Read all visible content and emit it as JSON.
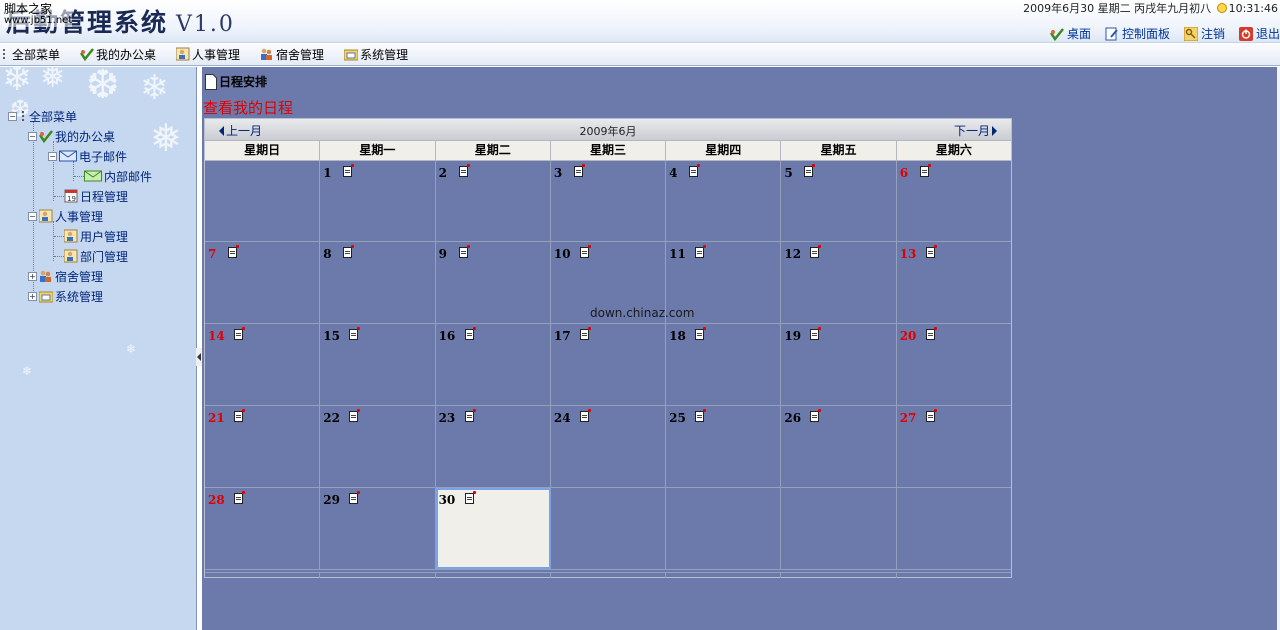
{
  "header": {
    "title": "后勤管理系统",
    "version": "V1.0",
    "watermark_line1": "脚本之家",
    "watermark_line2": "www.jb51.net",
    "datetime_date": "2009年6月30",
    "datetime_weekday": "星期二",
    "datetime_lunar": "丙戌年九月初八",
    "datetime_time": "10:31:46",
    "links": [
      "桌面",
      "控制面板",
      "注销",
      "退出"
    ]
  },
  "menubar": {
    "items": [
      {
        "label": "全部菜单",
        "icon": "dotted-menu-icon"
      },
      {
        "label": "我的办公桌",
        "icon": "check-leaf-icon"
      },
      {
        "label": "人事管理",
        "icon": "person-card-icon"
      },
      {
        "label": "宿舍管理",
        "icon": "people-group-icon"
      },
      {
        "label": "系统管理",
        "icon": "folder-window-icon"
      }
    ]
  },
  "tree": {
    "root": "全部菜单",
    "desk": "我的办公桌",
    "email": "电子邮件",
    "internal_mail": "内部邮件",
    "schedule": "日程管理",
    "hr": "人事管理",
    "users": "用户管理",
    "departments": "部门管理",
    "dorm": "宿舍管理",
    "system": "系统管理"
  },
  "main": {
    "doc_title": "日程安排",
    "view_link": "查看我的日程",
    "watermark": "down.chinaz.com"
  },
  "calendar": {
    "prev_label": "上一月",
    "next_label": "下一月",
    "month_title": "2009年6月",
    "weekdays": [
      "星期日",
      "星期一",
      "星期二",
      "星期三",
      "星期四",
      "星期五",
      "星期六"
    ],
    "weeks": [
      [
        "",
        "1",
        "2",
        "3",
        "4",
        "5",
        "6"
      ],
      [
        "7",
        "8",
        "9",
        "10",
        "11",
        "12",
        "13"
      ],
      [
        "14",
        "15",
        "16",
        "17",
        "18",
        "19",
        "20"
      ],
      [
        "21",
        "22",
        "23",
        "24",
        "25",
        "26",
        "27"
      ],
      [
        "28",
        "29",
        "30",
        "",
        "",
        "",
        ""
      ]
    ],
    "today": "30",
    "colors": {
      "weekend": "#e00000",
      "today_bg": "#f0efea",
      "cell_bg": "#6b7aaa"
    }
  }
}
